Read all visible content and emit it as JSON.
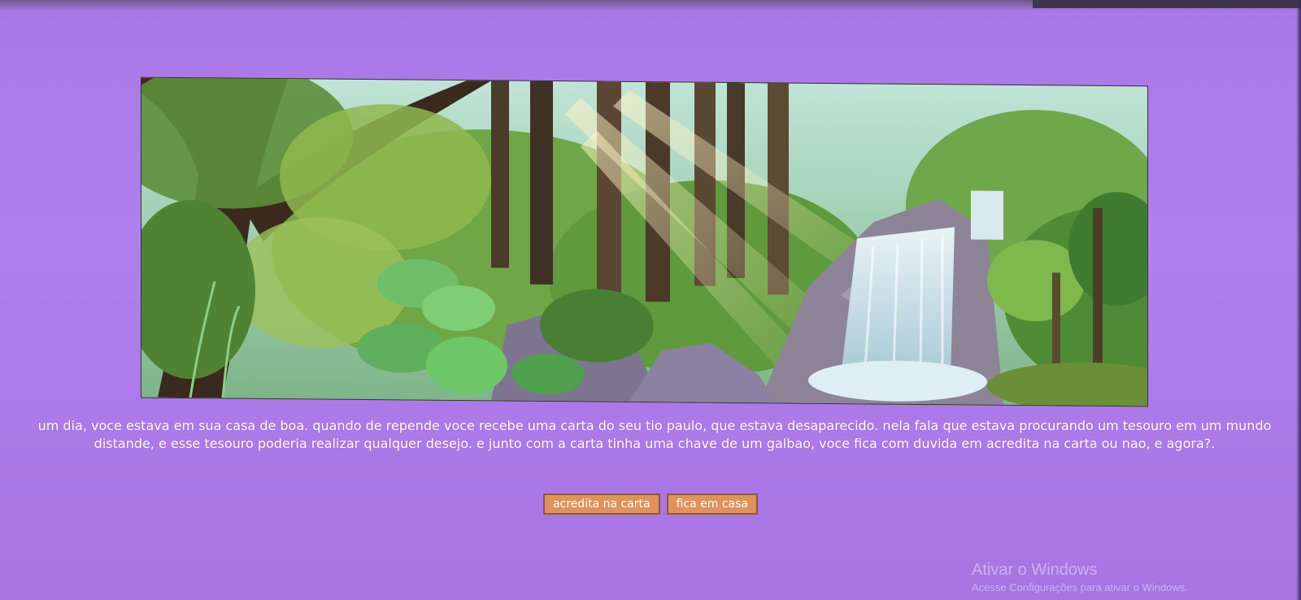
{
  "scene": {
    "alt": "forest-waterfall-illustration"
  },
  "story": {
    "text": "um dia, voce estava em sua casa de boa. quando de repende voce recebe uma carta do seu tio paulo, que estava desaparecido. nela fala que estava procurando um tesouro em um mundo distande, e esse tesouro poderia realizar qualquer desejo. e junto com a carta tinha uma chave de um galbao, voce fica com duvida em acredita na carta ou nao, e agora?."
  },
  "choices": {
    "believe_label": "acredita na carta",
    "stay_label": "fica em casa"
  },
  "watermark": {
    "title": "Ativar o Windows",
    "subtitle": "Acesse Configurações para ativar o Windows."
  },
  "colors": {
    "background": "#b07fee",
    "button": "#e0915c",
    "button_border": "#8d5a2c"
  }
}
